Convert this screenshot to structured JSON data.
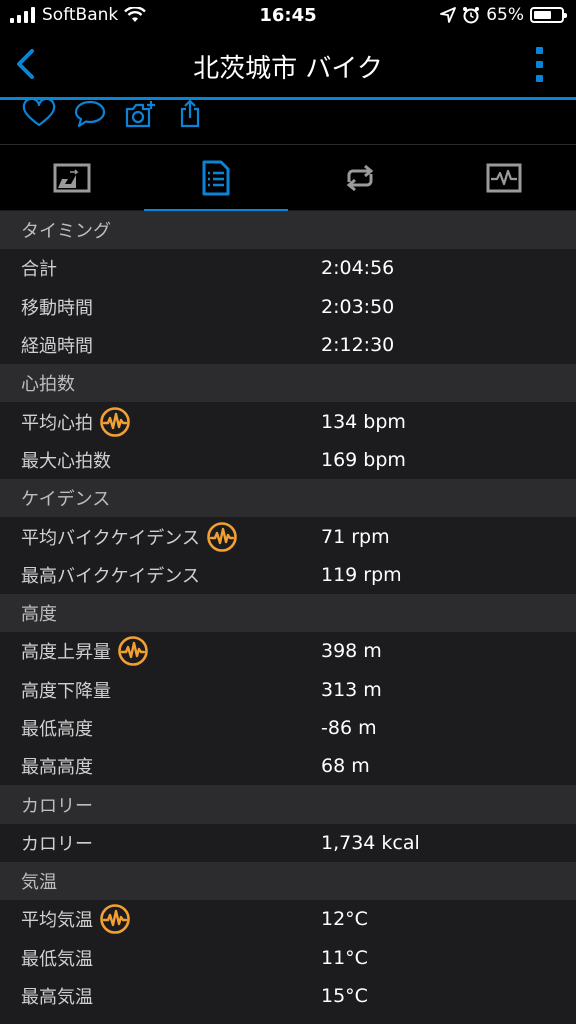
{
  "status": {
    "carrier": "SoftBank",
    "time": "16:45",
    "battery": "65%",
    "battery_level": 0.65
  },
  "nav": {
    "title": "北茨城市 バイク"
  },
  "colors": {
    "accent": "#0a84d6",
    "badge": "#f2a033"
  },
  "sections": [
    {
      "title": "タイミング",
      "rows": [
        {
          "label": "合計",
          "value": "2:04:56",
          "badge": false
        },
        {
          "label": "移動時間",
          "value": "2:03:50",
          "badge": false
        },
        {
          "label": "経過時間",
          "value": "2:12:30",
          "badge": false
        }
      ]
    },
    {
      "title": "心拍数",
      "rows": [
        {
          "label": "平均心拍",
          "value": "134 bpm",
          "badge": true
        },
        {
          "label": "最大心拍数",
          "value": "169 bpm",
          "badge": false
        }
      ]
    },
    {
      "title": "ケイデンス",
      "rows": [
        {
          "label": "平均バイクケイデンス",
          "value": "71 rpm",
          "badge": true
        },
        {
          "label": "最高バイクケイデンス",
          "value": "119 rpm",
          "badge": false
        }
      ]
    },
    {
      "title": "高度",
      "rows": [
        {
          "label": "高度上昇量",
          "value": "398 m",
          "badge": true
        },
        {
          "label": "高度下降量",
          "value": "313 m",
          "badge": false
        },
        {
          "label": "最低高度",
          "value": "-86 m",
          "badge": false
        },
        {
          "label": "最高高度",
          "value": "68 m",
          "badge": false
        }
      ]
    },
    {
      "title": "カロリー",
      "rows": [
        {
          "label": "カロリー",
          "value": "1,734 kcal",
          "badge": false
        }
      ]
    },
    {
      "title": "気温",
      "rows": [
        {
          "label": "平均気温",
          "value": "12°C",
          "badge": true
        },
        {
          "label": "最低気温",
          "value": "11°C",
          "badge": false
        },
        {
          "label": "最高気温",
          "value": "15°C",
          "badge": false
        }
      ]
    }
  ]
}
